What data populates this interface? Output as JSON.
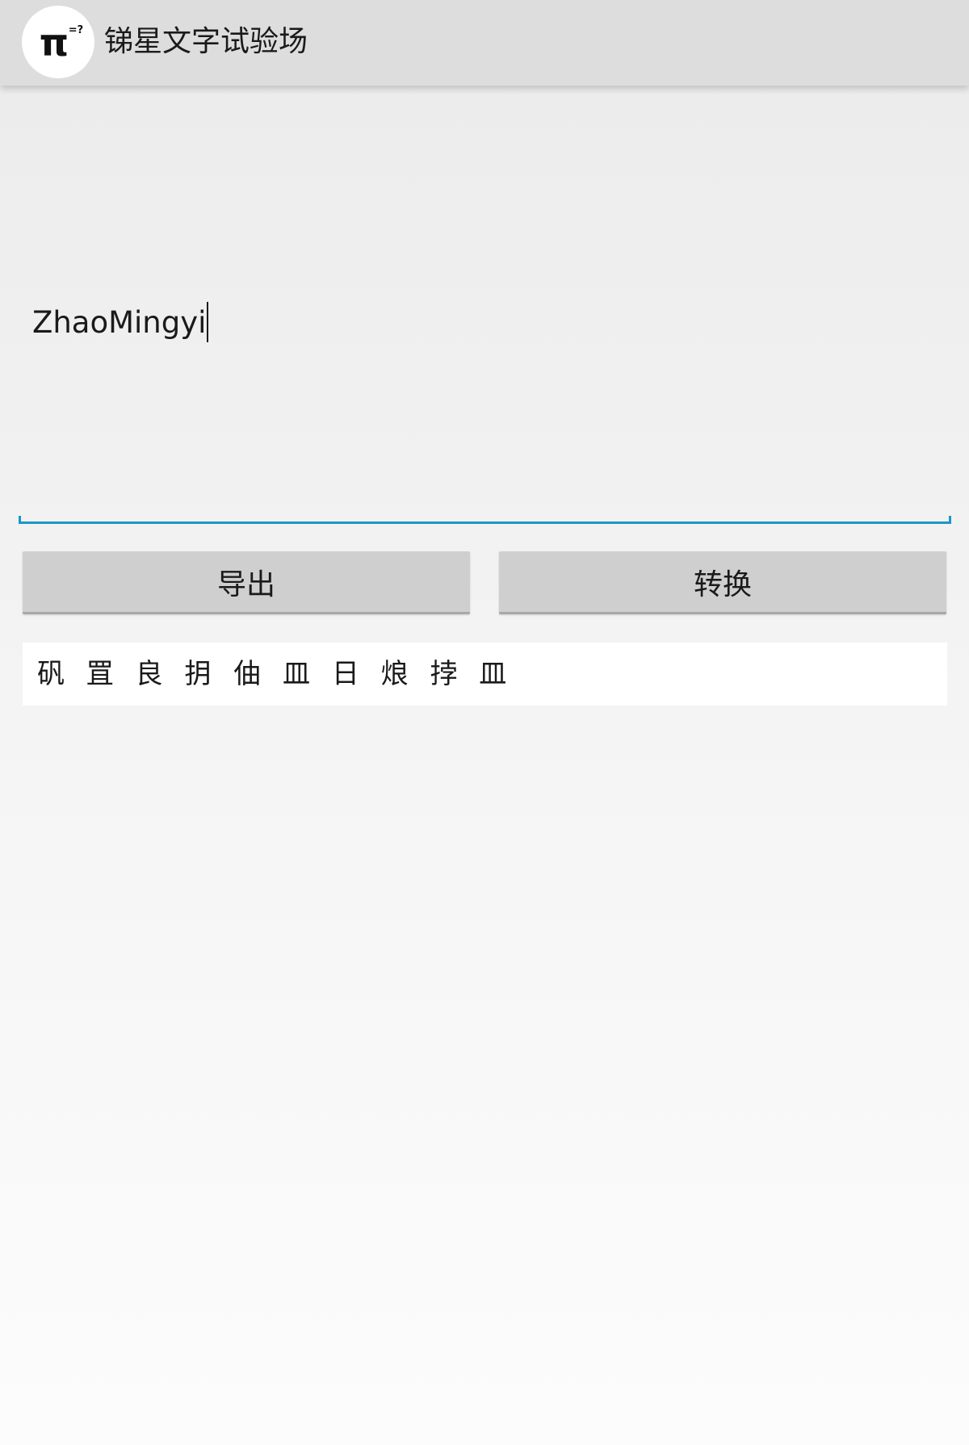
{
  "app": {
    "title": "锑星文字试验场",
    "icon": "pi-equals-question-logo",
    "icon_glyph": "π",
    "icon_sup": "=?"
  },
  "input": {
    "value": "ZhaoMingyi",
    "accent_color": "#1b97c9"
  },
  "buttons": {
    "export_label": "导出",
    "convert_label": "转换"
  },
  "result": {
    "text": "矾 罝 良 抈 伷 皿 日 烺 挬 皿"
  }
}
